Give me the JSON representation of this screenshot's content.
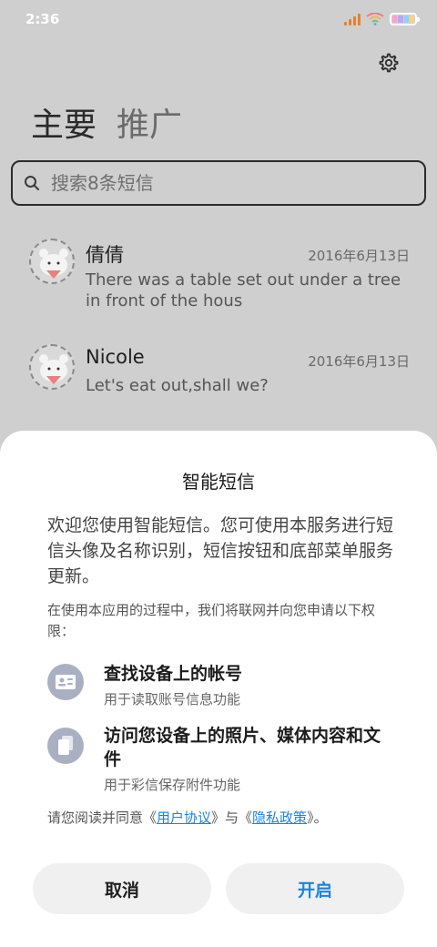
{
  "status": {
    "time": "2:36"
  },
  "tabs": [
    {
      "label": "主要"
    },
    {
      "label": "推广"
    }
  ],
  "search": {
    "placeholder": "搜索8条短信"
  },
  "messages": [
    {
      "name": "倩倩",
      "date": "2016年6月13日",
      "text": "There was a table set out under a tree in front of the hous"
    },
    {
      "name": "Nicole",
      "date": "2016年6月13日",
      "text": "Let's eat out,shall we?"
    }
  ],
  "dialog": {
    "title": "智能短信",
    "intro": "欢迎您使用智能短信。您可使用本服务进行短信头像及名称识别，短信按钮和底部菜单服务更新。",
    "perm_intro": "在使用本应用的过程中，我们将联网并向您申请以下权限：",
    "permissions": [
      {
        "title": "查找设备上的帐号",
        "subtitle": "用于读取账号信息功能"
      },
      {
        "title": "访问您设备上的照片、媒体内容和文件",
        "subtitle": "用于彩信保存附件功能"
      }
    ],
    "consent": {
      "prefix": "请您阅读并同意《",
      "user_agreement": "用户协议",
      "middle": "》与《",
      "privacy_policy": "隐私政策",
      "suffix": "》。"
    },
    "cancel_label": "取消",
    "open_label": "开启"
  },
  "colors": {
    "accent": "#1a84dc",
    "overlay": "#cfcfcf",
    "icon_bg": "#aab0c2"
  }
}
